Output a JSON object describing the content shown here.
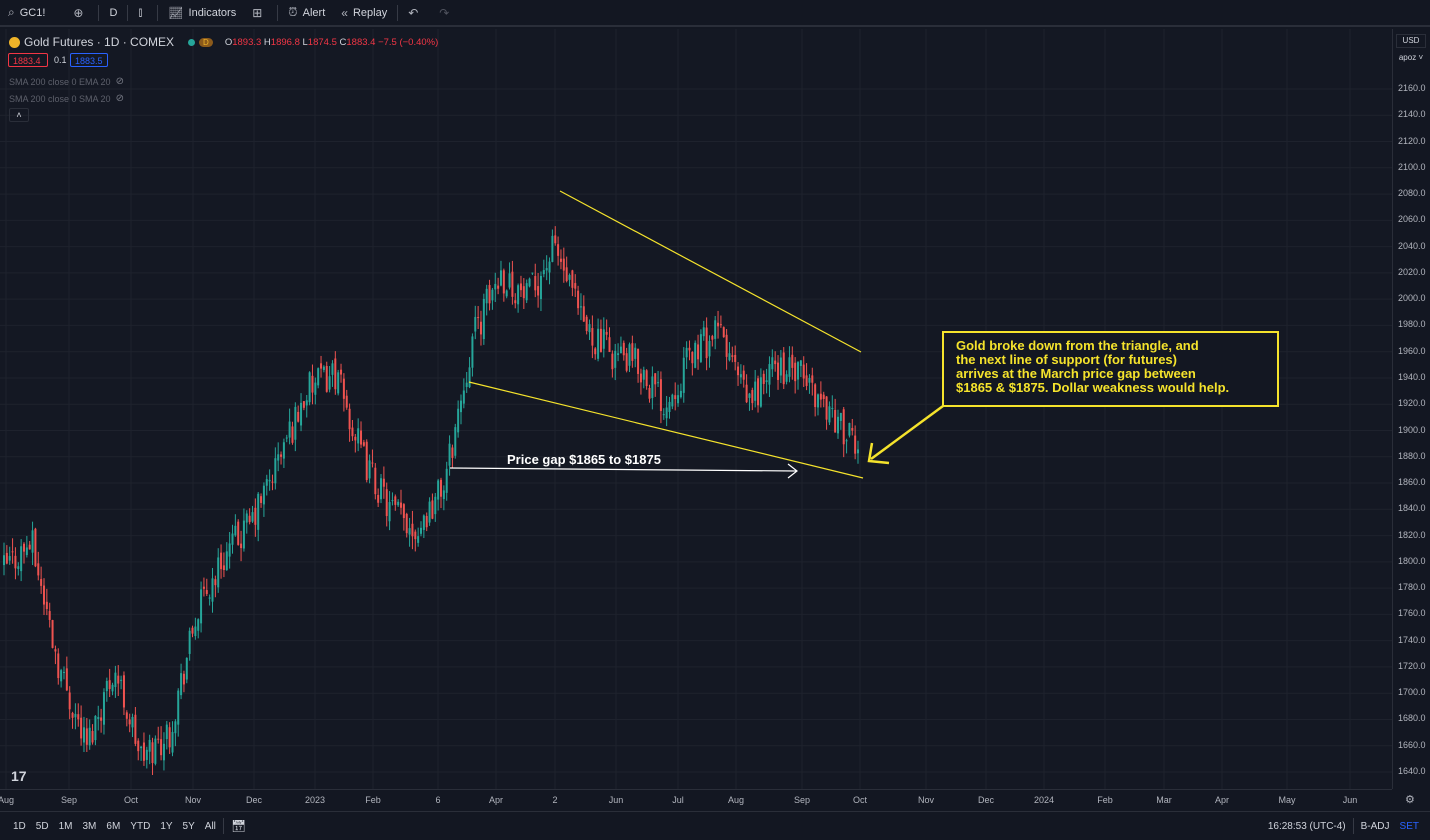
{
  "toolbar": {
    "symbol": "GC1!",
    "interval": "D",
    "indicators": "Indicators",
    "alert": "Alert",
    "replay": "Replay"
  },
  "legend": {
    "title": "Gold Futures · 1D · COMEX",
    "badge": "D",
    "open_label": "O",
    "open": "1893.3",
    "high_label": "H",
    "high": "1896.8",
    "low_label": "L",
    "low": "1874.5",
    "close_label": "C",
    "close": "1883.4",
    "change": "−7.5 (−0.40%)",
    "bid": "1883.4",
    "spread": "0.1",
    "ask": "1883.5",
    "indicator1": "SMA 200 close 0 EMA 20",
    "indicator2": "SMA 200 close 0 SMA 20"
  },
  "annotations": {
    "note_lines": [
      "Gold broke down from the triangle, and",
      "the next line of support (for futures)",
      "arrives at the March price gap between",
      "$1865 & $1875. Dollar weakness would help."
    ],
    "gap_label": "Price gap $1865 to $1875"
  },
  "price_axis": {
    "currency": "USD",
    "mode": "apoz",
    "labels": [
      "2160.0",
      "2140.0",
      "2120.0",
      "2100.0",
      "2080.0",
      "2060.0",
      "2040.0",
      "2020.0",
      "2000.0",
      "1980.0",
      "1960.0",
      "1940.0",
      "1920.0",
      "1900.0",
      "1880.0",
      "1860.0",
      "1840.0",
      "1820.0",
      "1800.0",
      "1780.0",
      "1760.0",
      "1740.0",
      "1720.0",
      "1700.0",
      "1680.0",
      "1660.0",
      "1640.0"
    ]
  },
  "time_axis": {
    "labels": [
      "Aug",
      "Sep",
      "Oct",
      "Nov",
      "Dec",
      "2023",
      "Feb",
      "6",
      "Apr",
      "2",
      "Jun",
      "Jul",
      "Aug",
      "Sep",
      "Oct",
      "Nov",
      "Dec",
      "2024",
      "Feb",
      "Mar",
      "Apr",
      "May",
      "Jun"
    ]
  },
  "bottom": {
    "ranges": [
      "1D",
      "5D",
      "1M",
      "3M",
      "6M",
      "YTD",
      "1Y",
      "5Y",
      "All"
    ],
    "time": "16:28:53 (UTC-4)",
    "badj": "B-ADJ",
    "set": "SET"
  },
  "colors": {
    "up": "#26a69a",
    "down": "#ef5350",
    "trendline": "#f5e32c",
    "background": "#131722"
  },
  "chart_data": {
    "type": "candlestick",
    "symbol": "GC1!",
    "trendlines": [
      {
        "from": [
          "2023-03-05",
          2082
        ],
        "to": [
          "2023-10-05",
          1960
        ]
      },
      {
        "from": [
          "2023-03-10",
          1938
        ],
        "to": [
          "2023-10-05",
          1864
        ]
      }
    ],
    "gap": {
      "low": 1865,
      "high": 1875
    },
    "approx_closes": [
      {
        "t": "Aug",
        "v": 1795
      },
      {
        "t": "mid Aug",
        "v": 1815
      },
      {
        "t": "Sep",
        "v": 1720
      },
      {
        "t": "late Sep",
        "v": 1660
      },
      {
        "t": "Oct",
        "v": 1720
      },
      {
        "t": "late Oct",
        "v": 1650
      },
      {
        "t": "Nov",
        "v": 1670
      },
      {
        "t": "mid Nov",
        "v": 1760
      },
      {
        "t": "Dec",
        "v": 1805
      },
      {
        "t": "late Dec",
        "v": 1830
      },
      {
        "t": "Jan",
        "v": 1880
      },
      {
        "t": "mid Jan",
        "v": 1930
      },
      {
        "t": "late Jan",
        "v": 1945
      },
      {
        "t": "Feb",
        "v": 1880
      },
      {
        "t": "mid Feb",
        "v": 1840
      },
      {
        "t": "late Feb",
        "v": 1825
      },
      {
        "t": "Mar",
        "v": 1860
      },
      {
        "t": "mid Mar",
        "v": 1970
      },
      {
        "t": "Apr",
        "v": 2020
      },
      {
        "t": "mid Apr",
        "v": 2000
      },
      {
        "t": "May",
        "v": 2040
      },
      {
        "t": "mid May",
        "v": 1980
      },
      {
        "t": "Jun",
        "v": 1960
      },
      {
        "t": "mid Jun",
        "v": 1950
      },
      {
        "t": "Jul",
        "v": 1920
      },
      {
        "t": "mid Jul",
        "v": 1960
      },
      {
        "t": "Aug",
        "v": 1975
      },
      {
        "t": "mid Aug",
        "v": 1920
      },
      {
        "t": "Sep",
        "v": 1950
      },
      {
        "t": "mid Sep",
        "v": 1940
      },
      {
        "t": "late Sep",
        "v": 1915
      },
      {
        "t": "Oct",
        "v": 1883
      }
    ],
    "ylim": [
      1630,
      2170
    ]
  }
}
